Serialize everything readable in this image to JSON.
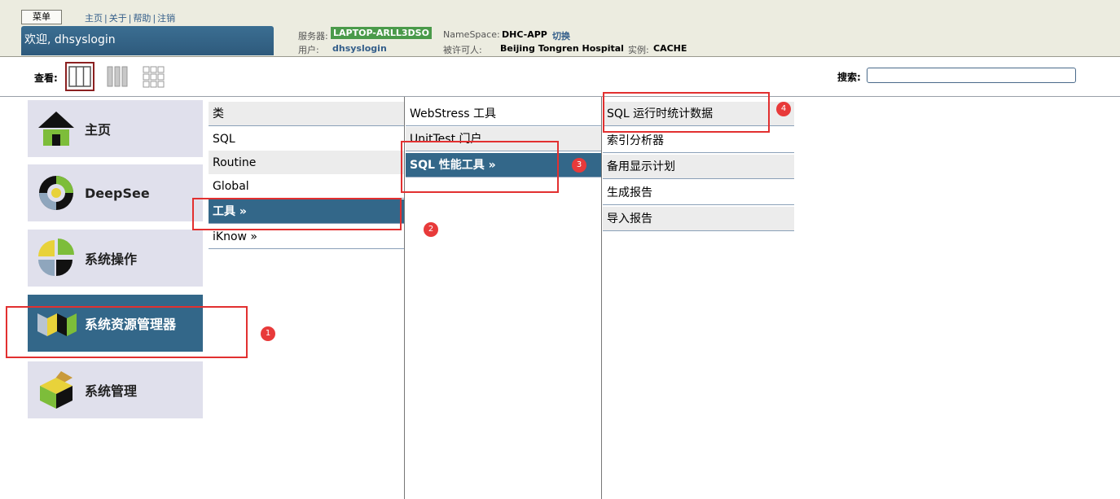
{
  "header": {
    "menu_label": "菜单",
    "links": [
      "主页",
      "关于",
      "帮助",
      "注销"
    ],
    "link_separator": "|",
    "welcome": "欢迎, dhsyslogin",
    "server_label": "服务器:",
    "server_value": "LAPTOP-ARLL3DSO",
    "namespace_label": "NameSpace:",
    "namespace_value": "DHC-APP",
    "namespace_switch": "切换",
    "user_label": "用户:",
    "user_value": "dhsyslogin",
    "licensee_label": "被许可人:",
    "licensee_value": "Beijing Tongren Hospital",
    "instance_label": "实例:",
    "instance_value": "CACHE"
  },
  "viewbar": {
    "label": "查看:",
    "search_label": "搜索:",
    "search_value": ""
  },
  "tiles": [
    {
      "label": "主页",
      "icon": "home-icon"
    },
    {
      "label": "DeepSee",
      "icon": "deepsee-icon"
    },
    {
      "label": "系统操作",
      "icon": "system-operation-icon"
    },
    {
      "label": "系统资源管理器",
      "icon": "system-explorer-icon",
      "active": true
    },
    {
      "label": "系统管理",
      "icon": "system-admin-icon"
    }
  ],
  "column1": [
    "类",
    "SQL",
    "Routine",
    "Global",
    "工具 »",
    "iKnow »"
  ],
  "column2": [
    "WebStress 工具",
    "UnitTest 门户",
    "SQL 性能工具 »"
  ],
  "column3": [
    "SQL 运行时统计数据",
    "索引分析器",
    "备用显示计划",
    "生成报告",
    "导入报告"
  ],
  "annotations": [
    "1",
    "2",
    "3",
    "4"
  ],
  "colors": {
    "accent": "#336789",
    "header_bg": "#ecece0",
    "tile_bg": "#e0e0ec",
    "server_badge": "#4a9a4a",
    "annotation_red": "#e23030"
  }
}
